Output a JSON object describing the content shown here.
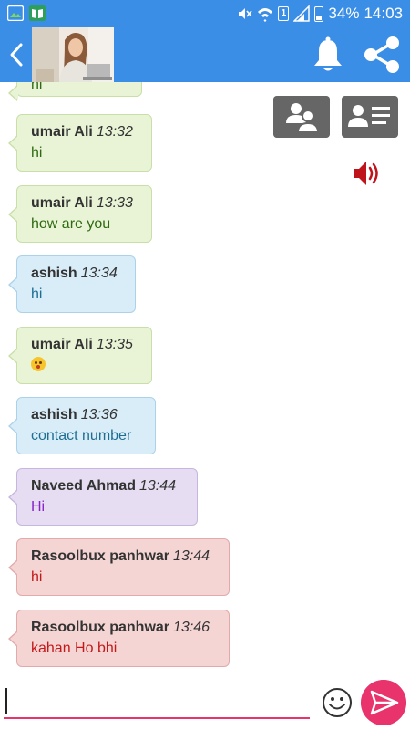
{
  "status_bar": {
    "battery": "34%",
    "time": "14:03",
    "sim_slot": "1"
  },
  "app_bar": {
    "icons": [
      "back-arrow-icon",
      "bell-icon",
      "share-icon"
    ]
  },
  "messages": [
    {
      "sender": "",
      "time": "",
      "text": "hi",
      "color": "green"
    },
    {
      "sender": "umair Ali",
      "time": "13:32",
      "text": "hi",
      "color": "green"
    },
    {
      "sender": "umair Ali",
      "time": "13:33",
      "text": "how are you",
      "color": "green"
    },
    {
      "sender": "ashish",
      "time": "13:34",
      "text": "hi",
      "color": "blue"
    },
    {
      "sender": "umair Ali",
      "time": "13:35",
      "text": "",
      "emoji": "kiss-face-emoji",
      "color": "green"
    },
    {
      "sender": "ashish",
      "time": "13:36",
      "text": "contact number",
      "color": "blue"
    },
    {
      "sender": "Naveed Ahmad",
      "time": "13:44",
      "text": "Hi",
      "color": "purple"
    },
    {
      "sender": "Rasoolbux panhwar",
      "time": "13:44",
      "text": "hi",
      "color": "red"
    },
    {
      "sender": "Rasoolbux panhwar",
      "time": "13:46",
      "text": "kahan Ho bhi",
      "color": "red"
    }
  ],
  "side_actions": {
    "icons": [
      "group-users-icon",
      "contact-card-icon",
      "speaker-icon"
    ]
  },
  "composer": {
    "input_value": "",
    "icons": [
      "emoji-icon",
      "send-icon"
    ]
  },
  "colors": {
    "app_bar": "#3a8ee6",
    "accent": "#e8336d",
    "bubble_green": "#e9f4d6",
    "bubble_blue": "#d9edf8",
    "bubble_purple": "#e6ddf2",
    "bubble_red": "#f5d4d4"
  }
}
